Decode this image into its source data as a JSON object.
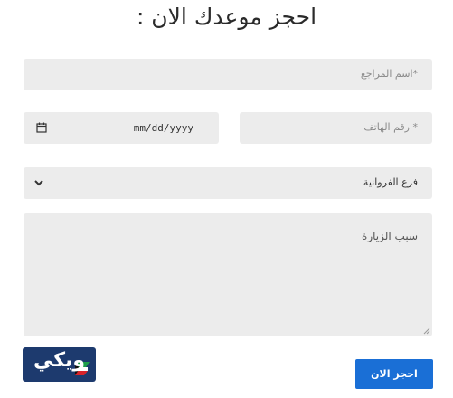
{
  "form": {
    "title": "احجز موعدك الان :",
    "name_placeholder": "*اسم المراجع",
    "date_value": "mm/dd/yyyy",
    "phone_placeholder": "* رقم الهاتف",
    "branch_selected": "فرع الفروانية",
    "reason_placeholder": "سبب الزيارة",
    "submit_label": "احجز الان"
  },
  "logo": {
    "text": "ويكي"
  },
  "colors": {
    "field_bg": "#ececec",
    "button_bg": "#1a6fd6",
    "logo_bg": "#1d3a6e"
  }
}
